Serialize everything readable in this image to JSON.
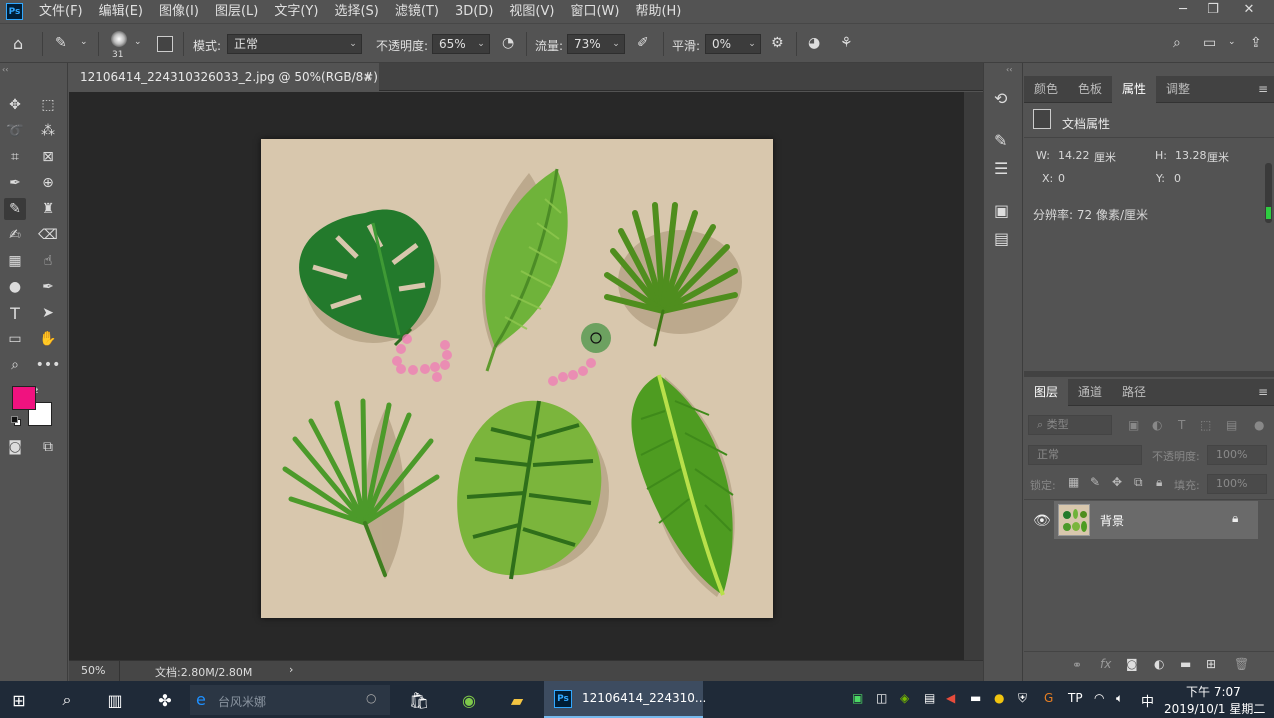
{
  "menubar": {
    "logo": "Ps",
    "items": [
      "文件(F)",
      "编辑(E)",
      "图像(I)",
      "图层(L)",
      "文字(Y)",
      "选择(S)",
      "滤镜(T)",
      "3D(D)",
      "视图(V)",
      "窗口(W)",
      "帮助(H)"
    ]
  },
  "options": {
    "brush_size": "31",
    "mode_label": "模式:",
    "mode_value": "正常",
    "opacity_label": "不透明度:",
    "opacity_value": "65%",
    "flow_label": "流量:",
    "flow_value": "73%",
    "smoothing_label": "平滑:",
    "smoothing_value": "0%"
  },
  "document": {
    "tab_title": "12106414_224310326033_2.jpg @ 50%(RGB/8#) *",
    "close": "×"
  },
  "colors": {
    "foreground": "#f0127f",
    "background": "#ffffff",
    "canvas_bg": "#d8c7ad",
    "accent_brush_marks": "#f07ab5"
  },
  "status": {
    "zoom": "50%",
    "doc_info": "文档:2.80M/2.80M",
    "arrow": "›"
  },
  "properties_panel": {
    "tabs": [
      "颜色",
      "色板",
      "属性",
      "调整"
    ],
    "active_tab": "属性",
    "header": "文档属性",
    "w_label": "W:",
    "w_value": "14.22",
    "w_unit": "厘米",
    "h_label": "H:",
    "h_value": "13.28",
    "h_unit": "厘米",
    "x_label": "X:",
    "x_value": "0",
    "y_label": "Y:",
    "y_value": "0",
    "resolution": "分辨率: 72 像素/厘米"
  },
  "layers_panel": {
    "tabs": [
      "图层",
      "通道",
      "路径"
    ],
    "active_tab": "图层",
    "filter_placeholder": "类型",
    "blend_mode": "正常",
    "opacity_label": "不透明度:",
    "opacity_value": "100%",
    "lock_label": "锁定:",
    "fill_label": "填充:",
    "fill_value": "100%",
    "layers": [
      {
        "name": "背景",
        "visible": true,
        "locked": true
      }
    ]
  },
  "taskbar": {
    "search_placeholder": "台风米娜",
    "active_app_label": "12106414_224310...",
    "ime": "中",
    "time": "下午 7:07",
    "date": "2019/10/1 星期二"
  }
}
